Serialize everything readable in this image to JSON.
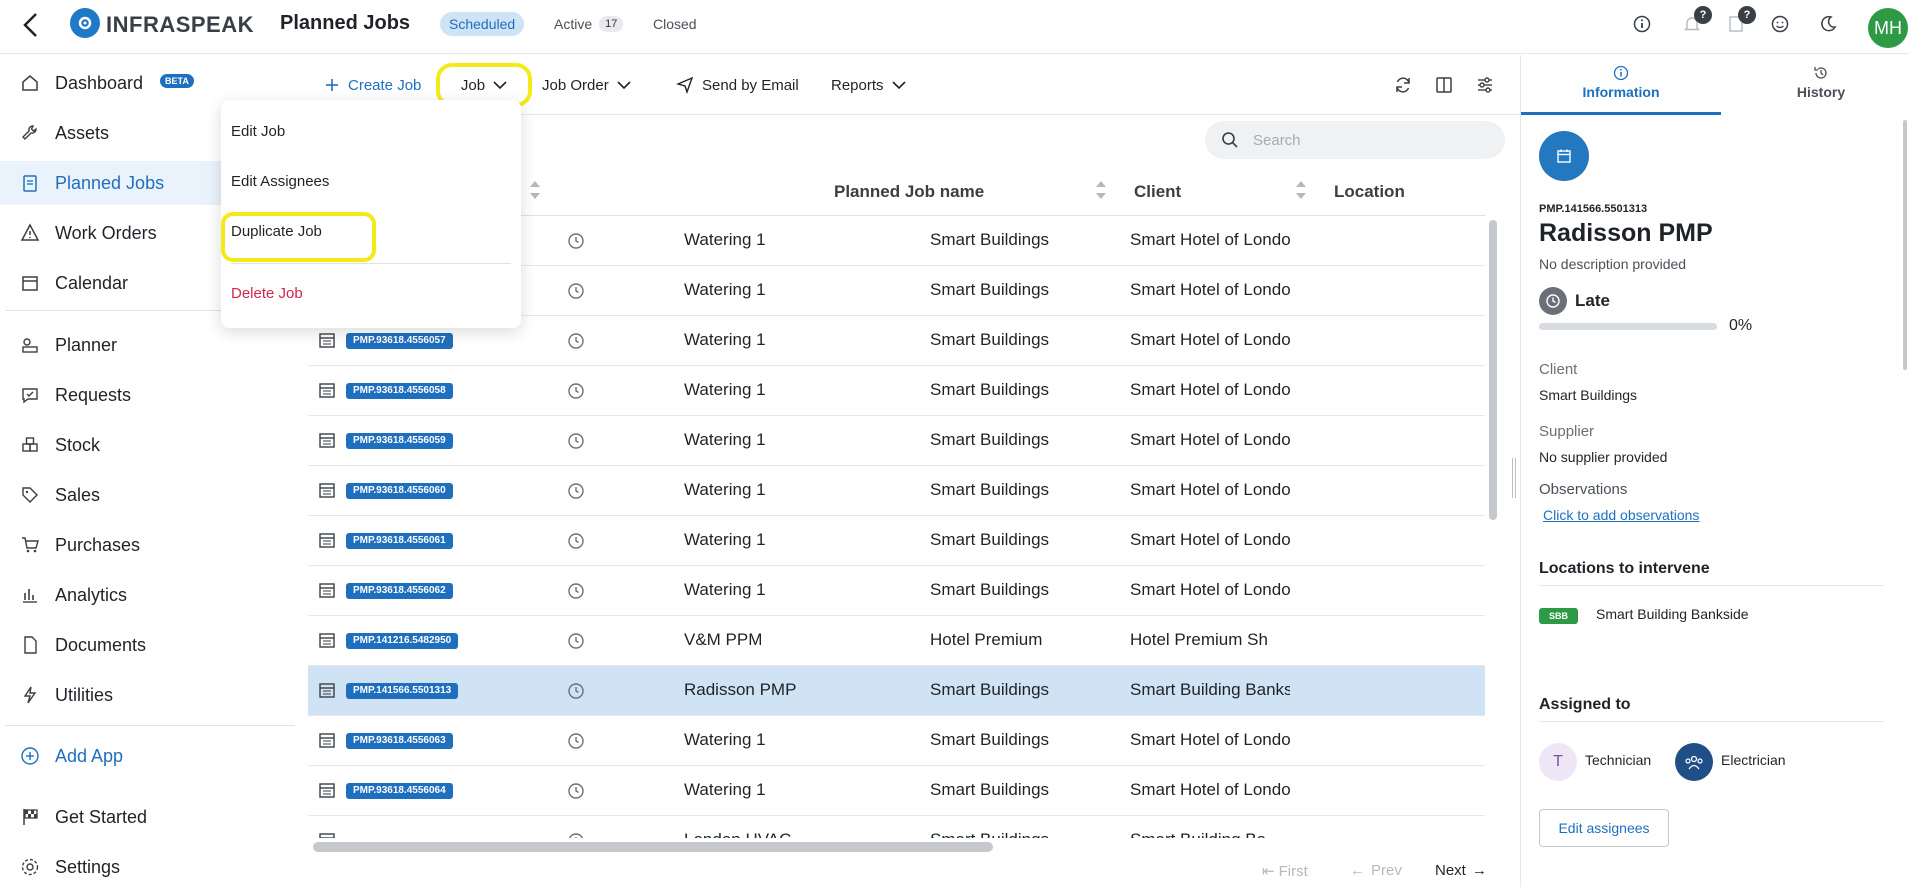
{
  "header": {
    "logo_text": "INFRASPEAK",
    "title": "Planned Jobs",
    "tabs": {
      "scheduled": "Scheduled",
      "active": "Active",
      "active_count": "17",
      "closed": "Closed"
    },
    "badge1": "?",
    "badge2": "?",
    "avatar_initials": "MH"
  },
  "sidebar": {
    "dashboard": "Dashboard",
    "beta": "BETA",
    "assets": "Assets",
    "planned_jobs": "Planned Jobs",
    "work_orders": "Work Orders",
    "calendar": "Calendar",
    "planner": "Planner",
    "requests": "Requests",
    "stock": "Stock",
    "sales": "Sales",
    "purchases": "Purchases",
    "analytics": "Analytics",
    "documents": "Documents",
    "utilities": "Utilities",
    "add_app": "Add App",
    "get_started": "Get Started",
    "settings": "Settings"
  },
  "toolbar": {
    "create_job": "Create Job",
    "job": "Job",
    "job_order": "Job Order",
    "send_email": "Send by Email",
    "reports": "Reports"
  },
  "search": {
    "placeholder": "Search"
  },
  "table": {
    "headers": {
      "name": "Planned Job name",
      "client": "Client",
      "location": "Location"
    },
    "rows": [
      {
        "code": "",
        "name": "Watering 1",
        "client": "Smart Buildings",
        "location": "Smart Hotel of London"
      },
      {
        "code": "",
        "name": "Watering 1",
        "client": "Smart Buildings",
        "location": "Smart Hotel of London"
      },
      {
        "code": "PMP.93618.4556057",
        "name": "Watering 1",
        "client": "Smart Buildings",
        "location": "Smart Hotel of London"
      },
      {
        "code": "PMP.93618.4556058",
        "name": "Watering 1",
        "client": "Smart Buildings",
        "location": "Smart Hotel of London"
      },
      {
        "code": "PMP.93618.4556059",
        "name": "Watering 1",
        "client": "Smart Buildings",
        "location": "Smart Hotel of London"
      },
      {
        "code": "PMP.93618.4556060",
        "name": "Watering 1",
        "client": "Smart Buildings",
        "location": "Smart Hotel of London"
      },
      {
        "code": "PMP.93618.4556061",
        "name": "Watering 1",
        "client": "Smart Buildings",
        "location": "Smart Hotel of London"
      },
      {
        "code": "PMP.93618.4556062",
        "name": "Watering 1",
        "client": "Smart Buildings",
        "location": "Smart Hotel of London"
      },
      {
        "code": "PMP.141216.5482950",
        "name": "V&M PPM",
        "client": "Hotel Premium",
        "location": "Hotel Premium Sh"
      },
      {
        "code": "PMP.141566.5501313",
        "name": "Radisson PMP",
        "client": "Smart Buildings",
        "location": "Smart Building Bankside"
      },
      {
        "code": "PMP.93618.4556063",
        "name": "Watering 1",
        "client": "Smart Buildings",
        "location": "Smart Hotel of London"
      },
      {
        "code": "PMP.93618.4556064",
        "name": "Watering 1",
        "client": "Smart Buildings",
        "location": "Smart Hotel of London"
      },
      {
        "code": "",
        "name": "London HVAC",
        "client": "Smart Buildings",
        "location": "Smart Building Ba"
      }
    ]
  },
  "pager": {
    "first": "First",
    "prev": "Prev",
    "next": "Next"
  },
  "dropdown": {
    "edit_job": "Edit Job",
    "edit_assignees": "Edit Assignees",
    "duplicate_job": "Duplicate Job",
    "delete_job": "Delete Job"
  },
  "panel": {
    "tab_info": "Information",
    "tab_history": "History",
    "code": "PMP.141566.5501313",
    "name": "Radisson PMP",
    "description": "No description provided",
    "status": "Late",
    "progress": 0,
    "progress_label": "0%",
    "client_label": "Client",
    "client_value": "Smart Buildings",
    "supplier_label": "Supplier",
    "supplier_value": "No supplier provided",
    "observations_label": "Observations",
    "observations_link": "Click to add observations",
    "locations_title": "Locations to intervene",
    "location_badge": "SBB",
    "location_name": "Smart Building Bankside",
    "assigned_title": "Assigned to",
    "assignee1_initial": "T",
    "assignee1": "Technician",
    "assignee2": "Electrician",
    "edit_assignees": "Edit assignees"
  }
}
